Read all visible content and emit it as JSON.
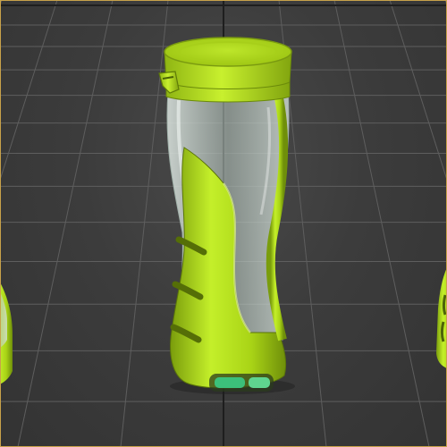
{
  "viewport": {
    "background_color": "#3c3c3c",
    "grid_color": "#5e5e5e",
    "grid_axis_color": "#1e1e1e",
    "border_color": "#c8a24a",
    "view": "perspective"
  },
  "scene": {
    "object": "bottle",
    "instances": 3,
    "accent_color": "#b5e61d",
    "accent_shadow_color": "#6f8f0a",
    "glass_color": "#c7d6cf",
    "indicator_color": "#3cc07a",
    "focused_instance": "center"
  }
}
